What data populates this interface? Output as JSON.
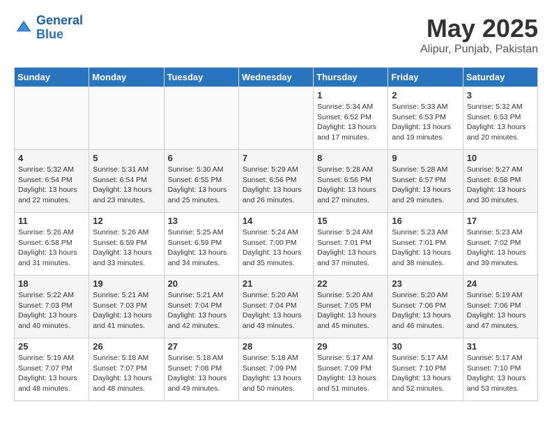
{
  "header": {
    "logo_line1": "General",
    "logo_line2": "Blue",
    "title": "May 2025",
    "subtitle": "Alipur, Punjab, Pakistan"
  },
  "days_of_week": [
    "Sunday",
    "Monday",
    "Tuesday",
    "Wednesday",
    "Thursday",
    "Friday",
    "Saturday"
  ],
  "weeks": [
    [
      {
        "day": "",
        "detail": ""
      },
      {
        "day": "",
        "detail": ""
      },
      {
        "day": "",
        "detail": ""
      },
      {
        "day": "",
        "detail": ""
      },
      {
        "day": "1",
        "detail": "Sunrise: 5:34 AM\nSunset: 6:52 PM\nDaylight: 13 hours\nand 17 minutes."
      },
      {
        "day": "2",
        "detail": "Sunrise: 5:33 AM\nSunset: 6:53 PM\nDaylight: 13 hours\nand 19 minutes."
      },
      {
        "day": "3",
        "detail": "Sunrise: 5:32 AM\nSunset: 6:53 PM\nDaylight: 13 hours\nand 20 minutes."
      }
    ],
    [
      {
        "day": "4",
        "detail": "Sunrise: 5:32 AM\nSunset: 6:54 PM\nDaylight: 13 hours\nand 22 minutes."
      },
      {
        "day": "5",
        "detail": "Sunrise: 5:31 AM\nSunset: 6:54 PM\nDaylight: 13 hours\nand 23 minutes."
      },
      {
        "day": "6",
        "detail": "Sunrise: 5:30 AM\nSunset: 6:55 PM\nDaylight: 13 hours\nand 25 minutes."
      },
      {
        "day": "7",
        "detail": "Sunrise: 5:29 AM\nSunset: 6:56 PM\nDaylight: 13 hours\nand 26 minutes."
      },
      {
        "day": "8",
        "detail": "Sunrise: 5:28 AM\nSunset: 6:56 PM\nDaylight: 13 hours\nand 27 minutes."
      },
      {
        "day": "9",
        "detail": "Sunrise: 5:28 AM\nSunset: 6:57 PM\nDaylight: 13 hours\nand 29 minutes."
      },
      {
        "day": "10",
        "detail": "Sunrise: 5:27 AM\nSunset: 6:58 PM\nDaylight: 13 hours\nand 30 minutes."
      }
    ],
    [
      {
        "day": "11",
        "detail": "Sunrise: 5:26 AM\nSunset: 6:58 PM\nDaylight: 13 hours\nand 31 minutes."
      },
      {
        "day": "12",
        "detail": "Sunrise: 5:26 AM\nSunset: 6:59 PM\nDaylight: 13 hours\nand 33 minutes."
      },
      {
        "day": "13",
        "detail": "Sunrise: 5:25 AM\nSunset: 6:59 PM\nDaylight: 13 hours\nand 34 minutes."
      },
      {
        "day": "14",
        "detail": "Sunrise: 5:24 AM\nSunset: 7:00 PM\nDaylight: 13 hours\nand 35 minutes."
      },
      {
        "day": "15",
        "detail": "Sunrise: 5:24 AM\nSunset: 7:01 PM\nDaylight: 13 hours\nand 37 minutes."
      },
      {
        "day": "16",
        "detail": "Sunrise: 5:23 AM\nSunset: 7:01 PM\nDaylight: 13 hours\nand 38 minutes."
      },
      {
        "day": "17",
        "detail": "Sunrise: 5:23 AM\nSunset: 7:02 PM\nDaylight: 13 hours\nand 39 minutes."
      }
    ],
    [
      {
        "day": "18",
        "detail": "Sunrise: 5:22 AM\nSunset: 7:03 PM\nDaylight: 13 hours\nand 40 minutes."
      },
      {
        "day": "19",
        "detail": "Sunrise: 5:21 AM\nSunset: 7:03 PM\nDaylight: 13 hours\nand 41 minutes."
      },
      {
        "day": "20",
        "detail": "Sunrise: 5:21 AM\nSunset: 7:04 PM\nDaylight: 13 hours\nand 42 minutes."
      },
      {
        "day": "21",
        "detail": "Sunrise: 5:20 AM\nSunset: 7:04 PM\nDaylight: 13 hours\nand 43 minutes."
      },
      {
        "day": "22",
        "detail": "Sunrise: 5:20 AM\nSunset: 7:05 PM\nDaylight: 13 hours\nand 45 minutes."
      },
      {
        "day": "23",
        "detail": "Sunrise: 5:20 AM\nSunset: 7:06 PM\nDaylight: 13 hours\nand 46 minutes."
      },
      {
        "day": "24",
        "detail": "Sunrise: 5:19 AM\nSunset: 7:06 PM\nDaylight: 13 hours\nand 47 minutes."
      }
    ],
    [
      {
        "day": "25",
        "detail": "Sunrise: 5:19 AM\nSunset: 7:07 PM\nDaylight: 13 hours\nand 48 minutes."
      },
      {
        "day": "26",
        "detail": "Sunrise: 5:18 AM\nSunset: 7:07 PM\nDaylight: 13 hours\nand 48 minutes."
      },
      {
        "day": "27",
        "detail": "Sunrise: 5:18 AM\nSunset: 7:08 PM\nDaylight: 13 hours\nand 49 minutes."
      },
      {
        "day": "28",
        "detail": "Sunrise: 5:18 AM\nSunset: 7:09 PM\nDaylight: 13 hours\nand 50 minutes."
      },
      {
        "day": "29",
        "detail": "Sunrise: 5:17 AM\nSunset: 7:09 PM\nDaylight: 13 hours\nand 51 minutes."
      },
      {
        "day": "30",
        "detail": "Sunrise: 5:17 AM\nSunset: 7:10 PM\nDaylight: 13 hours\nand 52 minutes."
      },
      {
        "day": "31",
        "detail": "Sunrise: 5:17 AM\nSunset: 7:10 PM\nDaylight: 13 hours\nand 53 minutes."
      }
    ]
  ]
}
